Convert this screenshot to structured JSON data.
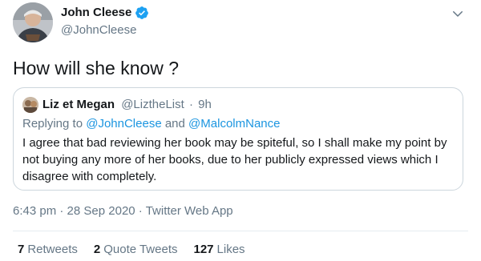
{
  "author": {
    "display_name": "John Cleese",
    "handle": "@JohnCleese",
    "verified": true
  },
  "tweet": {
    "text": "How will she know ?"
  },
  "quoted_tweet": {
    "display_name": "Liz et Megan",
    "handle": "@LiztheList",
    "separator": "·",
    "age": "9h",
    "replying_prefix": "Replying to",
    "replying_to_1": "@JohnCleese",
    "replying_and": "and",
    "replying_to_2": "@MalcolmNance",
    "body": "I agree that bad reviewing her book may be spiteful,  so I shall make my point by not buying any more of her books, due to her publicly expressed views which I disagree with completely."
  },
  "meta": {
    "time": "6:43 pm",
    "separator_1": "·",
    "date": "28 Sep 2020",
    "separator_2": "·",
    "source": "Twitter Web App"
  },
  "stats": {
    "retweets_count": "7",
    "retweets_label": "Retweets",
    "quote_count": "2",
    "quote_label": "Quote Tweets",
    "likes_count": "127",
    "likes_label": "Likes"
  },
  "colors": {
    "verified_blue": "#1da1f2",
    "link_blue": "#1b95e0",
    "secondary_text": "#657786",
    "border": "#ccd6dd"
  },
  "icons": {
    "verified": "verified-badge-icon",
    "caret": "chevron-down-icon"
  }
}
